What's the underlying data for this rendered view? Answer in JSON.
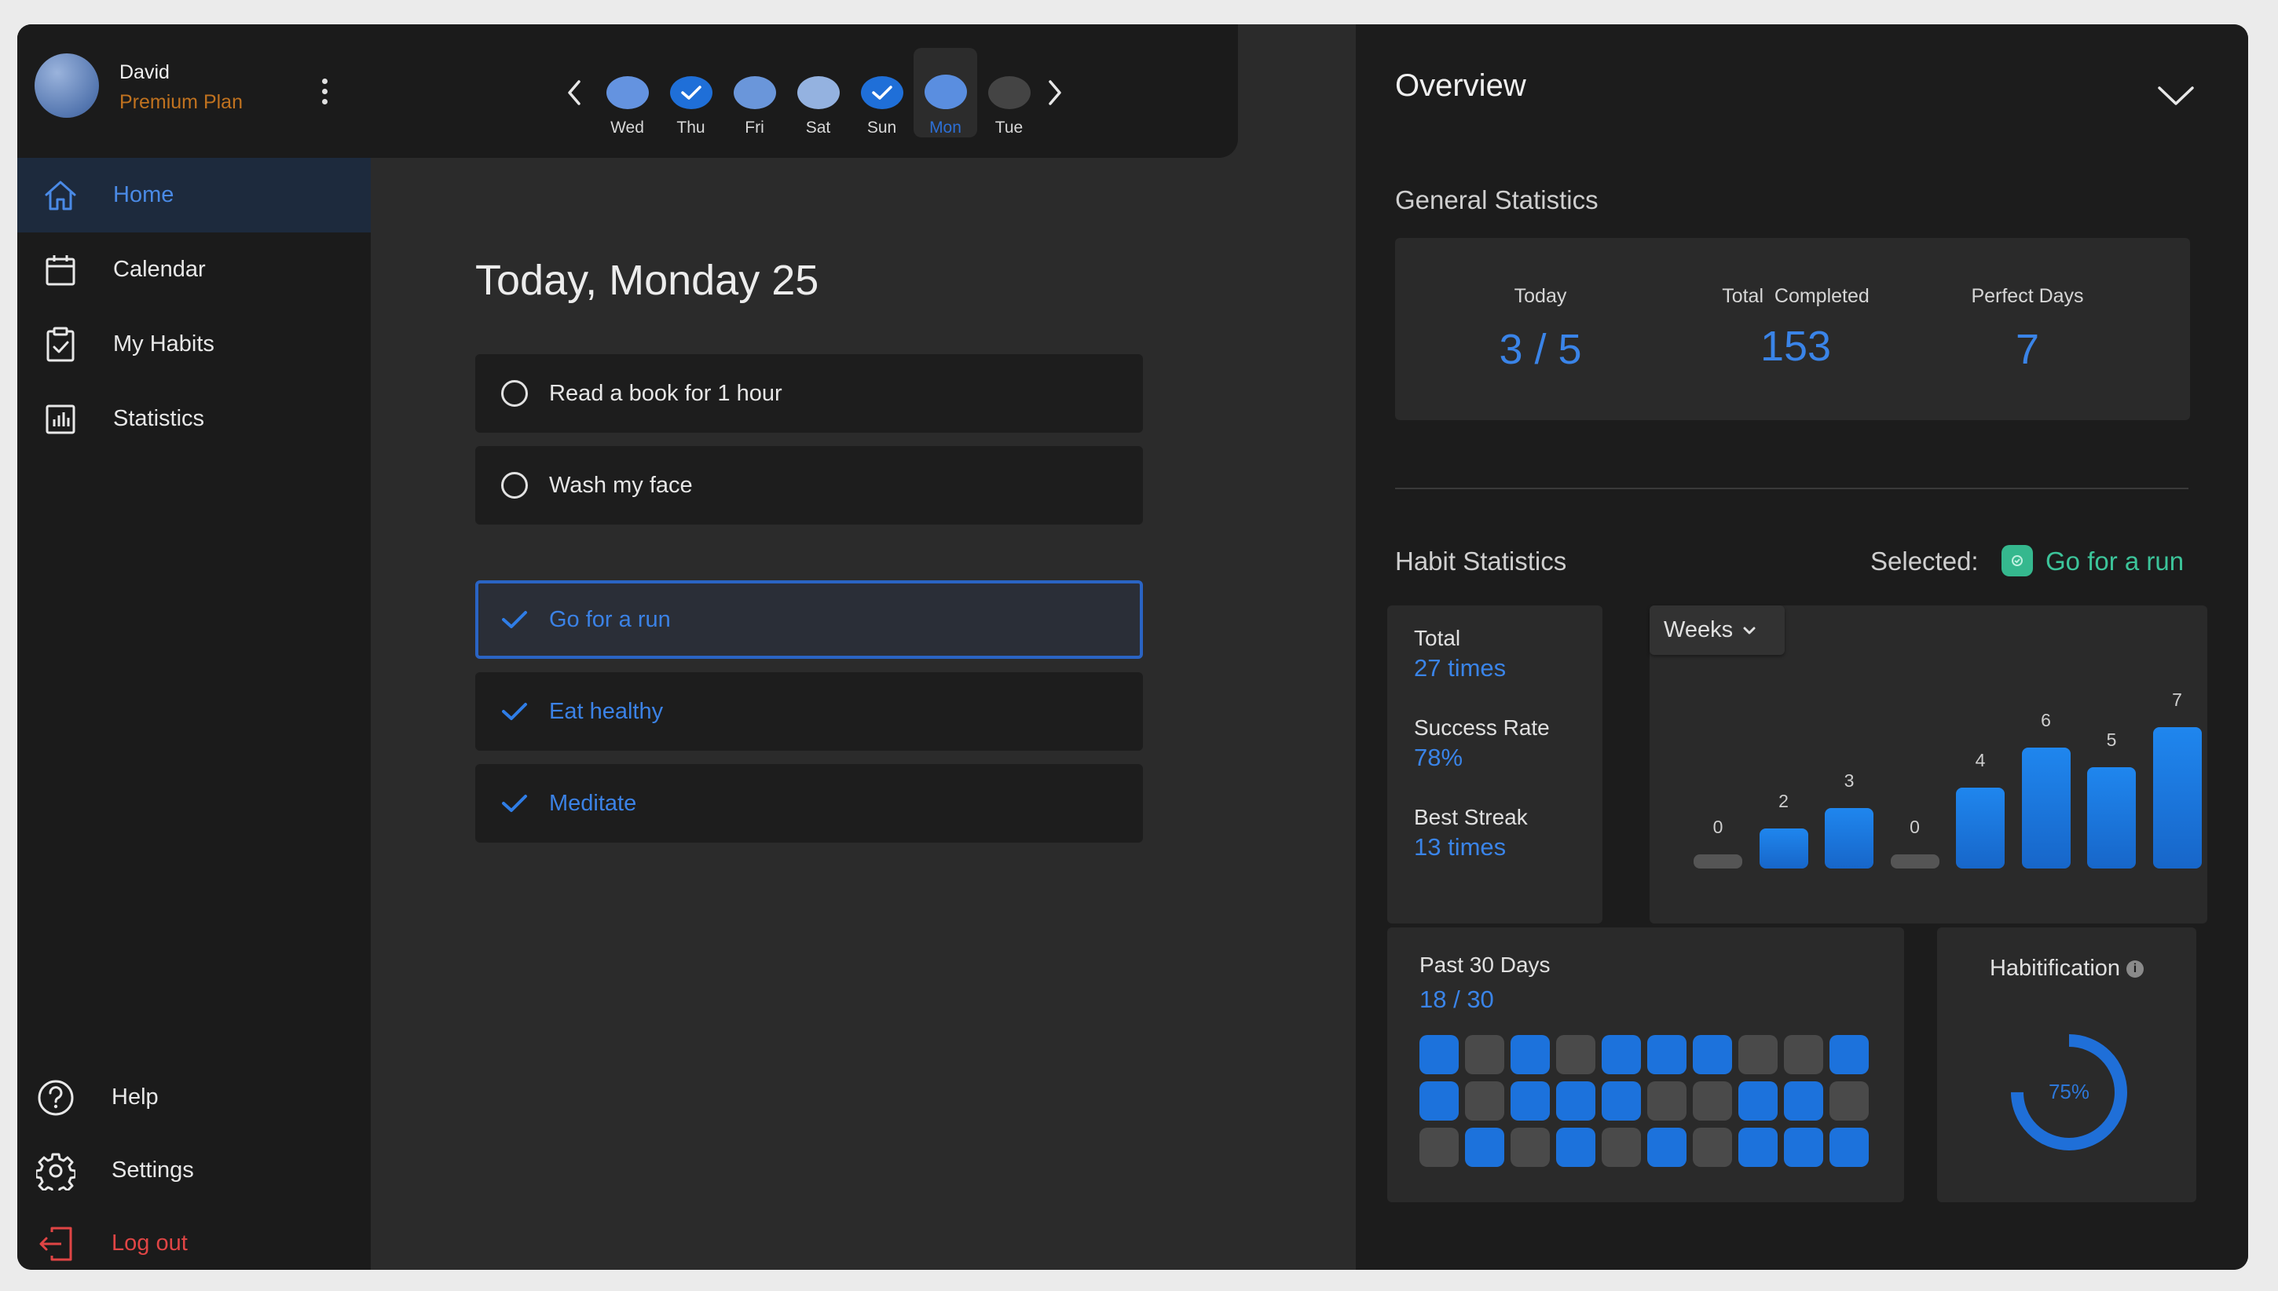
{
  "user": {
    "name": "David",
    "plan": "Premium Plan"
  },
  "week": {
    "days": [
      {
        "label": "Wed",
        "state": "light"
      },
      {
        "label": "Thu",
        "state": "checked"
      },
      {
        "label": "Fri",
        "state": "light"
      },
      {
        "label": "Sat",
        "state": "light"
      },
      {
        "label": "Sun",
        "state": "checked"
      },
      {
        "label": "Mon",
        "state": "active"
      },
      {
        "label": "Tue",
        "state": "future"
      }
    ]
  },
  "nav": {
    "home": "Home",
    "calendar": "Calendar",
    "my_habits": "My Habits",
    "statistics": "Statistics",
    "help": "Help",
    "settings": "Settings",
    "logout": "Log out"
  },
  "main": {
    "title": "Today, Monday 25",
    "pending": [
      "Read a book for 1 hour",
      "Wash my face"
    ],
    "done": [
      "Go for a run",
      "Eat healthy",
      "Meditate"
    ]
  },
  "overview": {
    "title": "Overview",
    "general_title": "General Statistics",
    "today_label": "Today",
    "today_value": "3 / 5",
    "total_label": "Total  Completed",
    "total_value": "153",
    "perfect_label": "Perfect Days",
    "perfect_value": "7",
    "habit_title": "Habit Statistics",
    "selected_label": "Selected:",
    "selected_habit": "Go for a run",
    "total_k": "Total",
    "total_v": "27 times",
    "success_k": "Success Rate",
    "success_v": "78%",
    "streak_k": "Best Streak",
    "streak_v": "13 times",
    "weeks_label": "Weeks",
    "past_title": "Past 30 Days",
    "past_value": "18 / 30",
    "habitification_title": "Habitification",
    "habitification_value": "75%",
    "habitification_fraction": 0.75
  },
  "chart_data": {
    "type": "bar",
    "values": [
      0,
      2,
      3,
      0,
      4,
      6,
      5,
      7
    ],
    "ylim": [
      0,
      7
    ]
  },
  "past30": [
    1,
    0,
    1,
    0,
    1,
    1,
    1,
    0,
    0,
    1,
    1,
    0,
    1,
    1,
    1,
    0,
    0,
    1,
    1,
    0,
    0,
    1,
    0,
    1,
    0,
    1,
    0,
    1,
    1,
    1
  ],
  "colors": {
    "accent": "#1f6fd8",
    "plan": "#c0721f",
    "logout": "#e04545",
    "selected": "#3cc49a"
  }
}
